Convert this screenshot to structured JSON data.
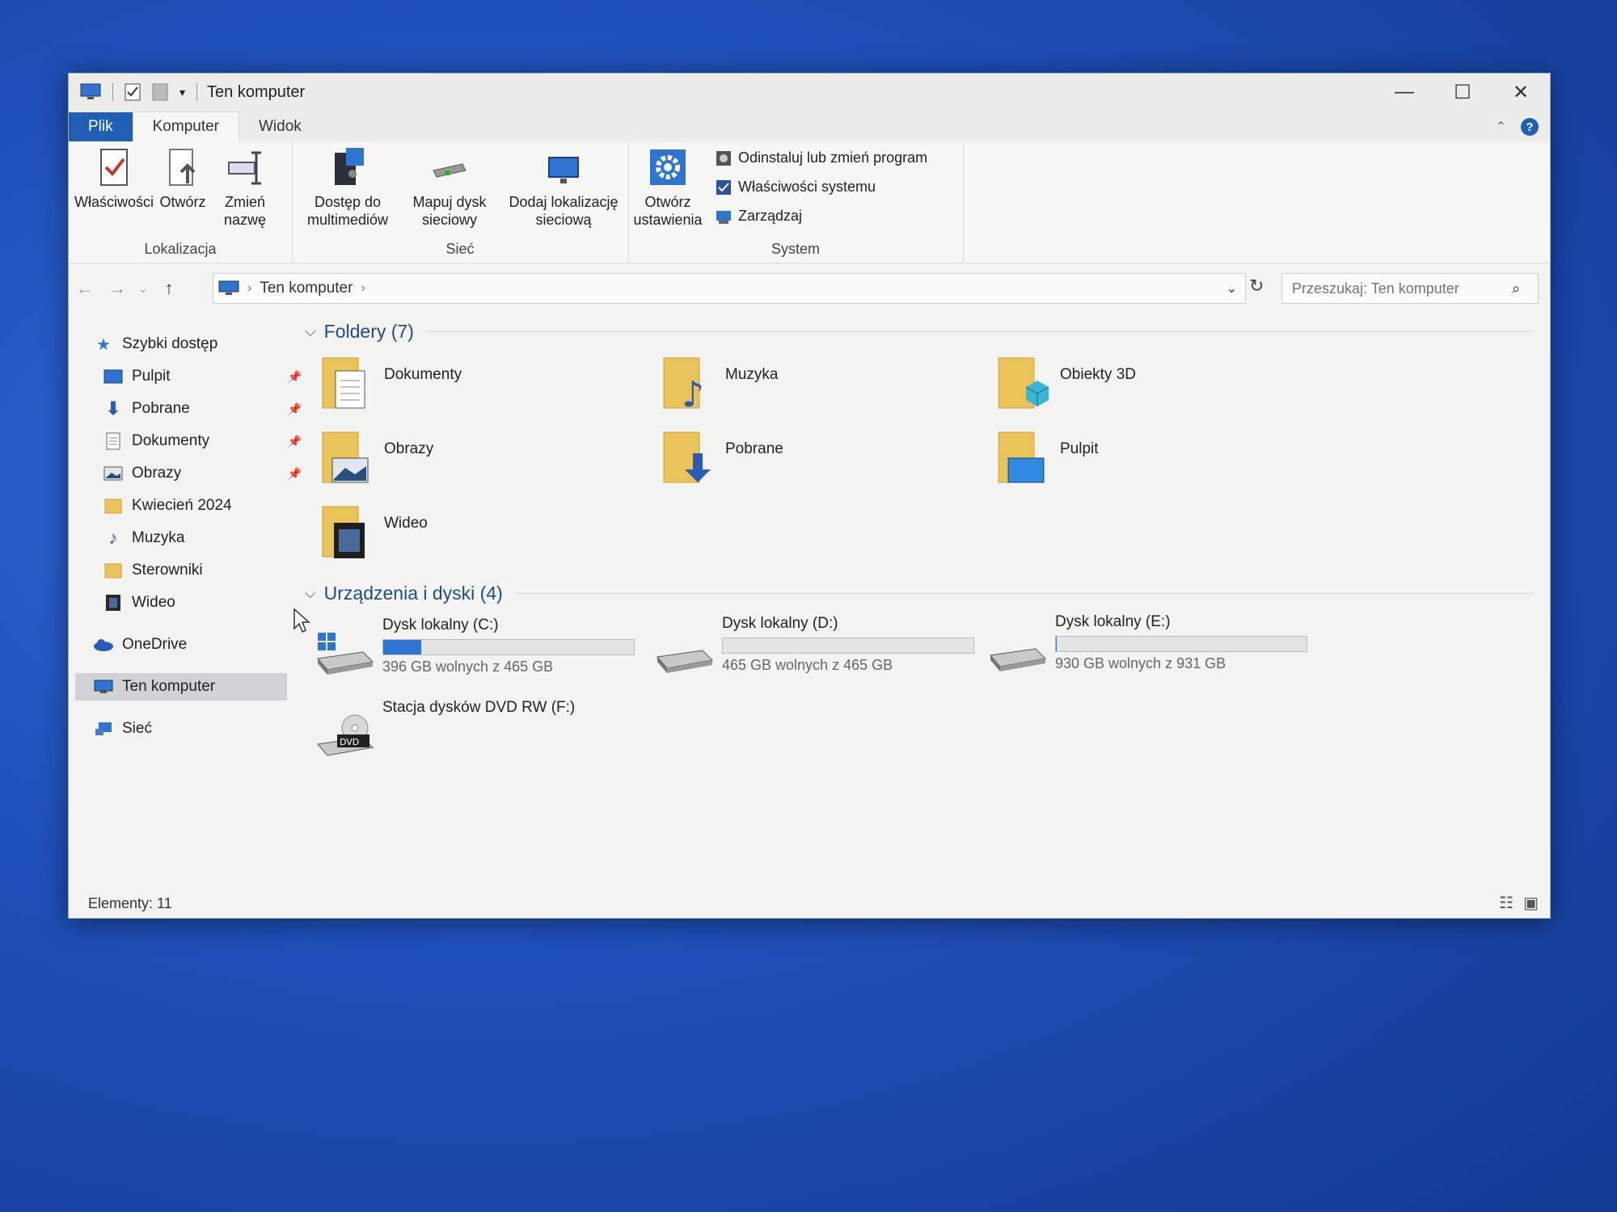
{
  "window": {
    "title": "Ten komputer",
    "controls": {
      "minimize": "—",
      "maximize": "☐",
      "close": "✕"
    }
  },
  "ribbon": {
    "tabs": [
      "Plik",
      "Komputer",
      "Widok"
    ],
    "active_tab": "Komputer",
    "groups": {
      "lokalizacja": {
        "label": "Lokalizacja",
        "buttons": [
          "Właściwości",
          "Otwórz",
          "Zmień nazwę"
        ]
      },
      "siec": {
        "label": "Sieć",
        "buttons": [
          "Dostęp do multimediów",
          "Mapuj dysk sieciowy",
          "Dodaj lokalizację sieciową"
        ]
      },
      "system": {
        "label": "System",
        "big_button": "Otwórz ustawienia",
        "small_buttons": [
          "Odinstaluj lub zmień program",
          "Właściwości systemu",
          "Zarządzaj"
        ]
      }
    }
  },
  "address": {
    "breadcrumb": "Ten komputer",
    "search_placeholder": "Przeszukaj: Ten komputer"
  },
  "sidebar": {
    "quick_access": "Szybki dostęp",
    "items": [
      "Pulpit",
      "Pobrane",
      "Dokumenty",
      "Obrazy",
      "Kwiecień 2024",
      "Muzyka",
      "Sterowniki",
      "Wideo"
    ],
    "onedrive": "OneDrive",
    "this_pc": "Ten komputer",
    "network": "Sieć"
  },
  "content": {
    "folders_header": "Foldery (7)",
    "folders": [
      "Dokumenty",
      "Muzyka",
      "Obiekty 3D",
      "Obrazy",
      "Pobrane",
      "Pulpit",
      "Wideo"
    ],
    "devices_header": "Urządzenia i dyski (4)",
    "drives": [
      {
        "name": "Dysk lokalny (C:)",
        "info": "396 GB wolnych z 465 GB",
        "used_fraction": 0.15
      },
      {
        "name": "Dysk lokalny (D:)",
        "info": "465 GB wolnych z 465 GB",
        "used_fraction": 0.0
      },
      {
        "name": "Dysk lokalny (E:)",
        "info": "930 GB wolnych z 931 GB",
        "used_fraction": 0.001
      }
    ],
    "dvd": {
      "name": "Stacja dysków DVD RW (F:)",
      "label": "DVD"
    }
  },
  "status": {
    "items": "Elementy: 11"
  },
  "colors": {
    "accent": "#1f5fb3",
    "folder": "#e8c45a",
    "drive_bar": "#2f74d0"
  }
}
